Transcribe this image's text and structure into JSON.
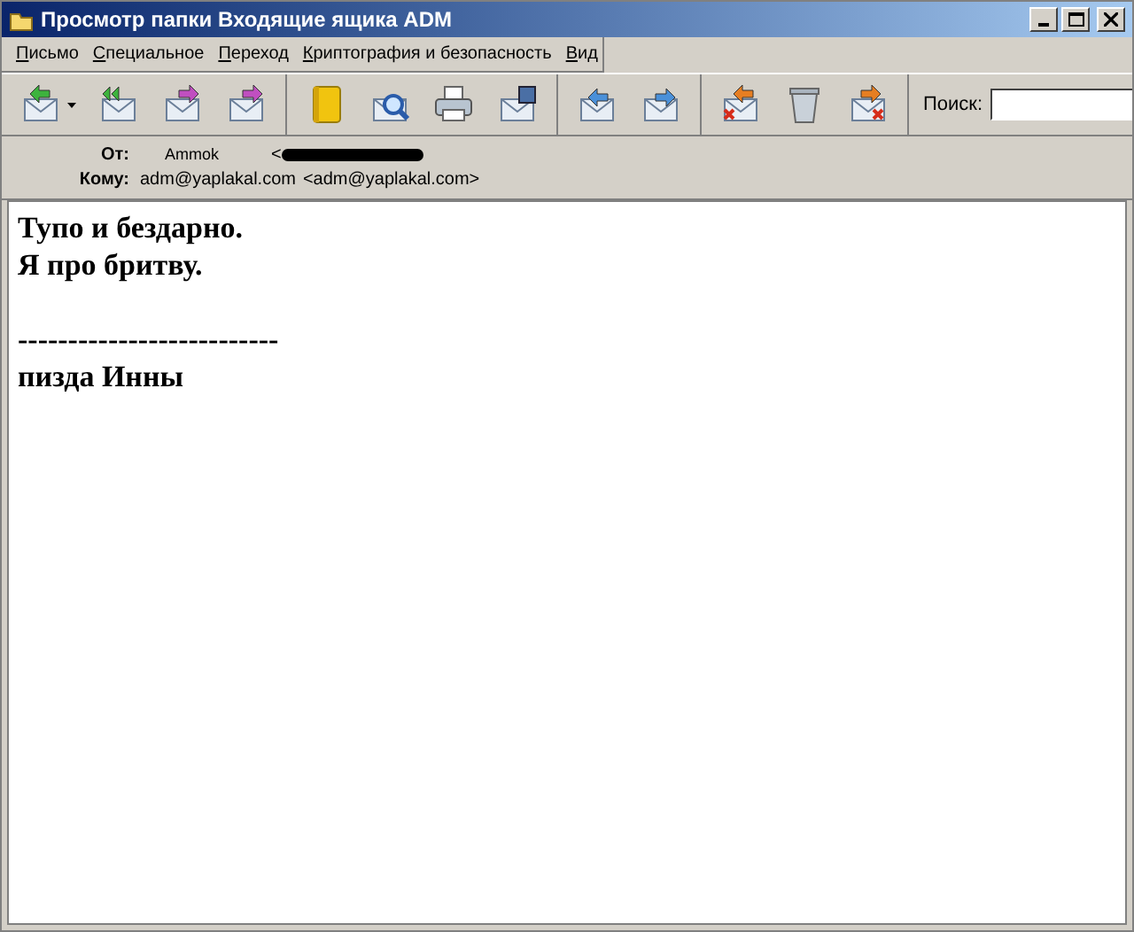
{
  "window": {
    "title": "Просмотр папки Входящие ящика ADM"
  },
  "menu": [
    "Письмо",
    "Специальное",
    "Переход",
    "Криптография и безопасность",
    "Вид"
  ],
  "search": {
    "label": "Поиск:"
  },
  "headers": [
    {
      "label": "От:",
      "value": "Ammok",
      "address": "<",
      "redacted": true
    },
    {
      "label": "Кому:",
      "value": "adm@yaplakal.com",
      "address": "<adm@yaplakal.com>",
      "redacted": false
    }
  ],
  "body": [
    {
      "kind": "text",
      "text": "Тупо и бездарно."
    },
    {
      "kind": "text",
      "text": "Я про бритву."
    },
    {
      "kind": "blank"
    },
    {
      "kind": "text",
      "text": "--------------------------"
    },
    {
      "kind": "text",
      "text": "пизда Инны"
    }
  ]
}
